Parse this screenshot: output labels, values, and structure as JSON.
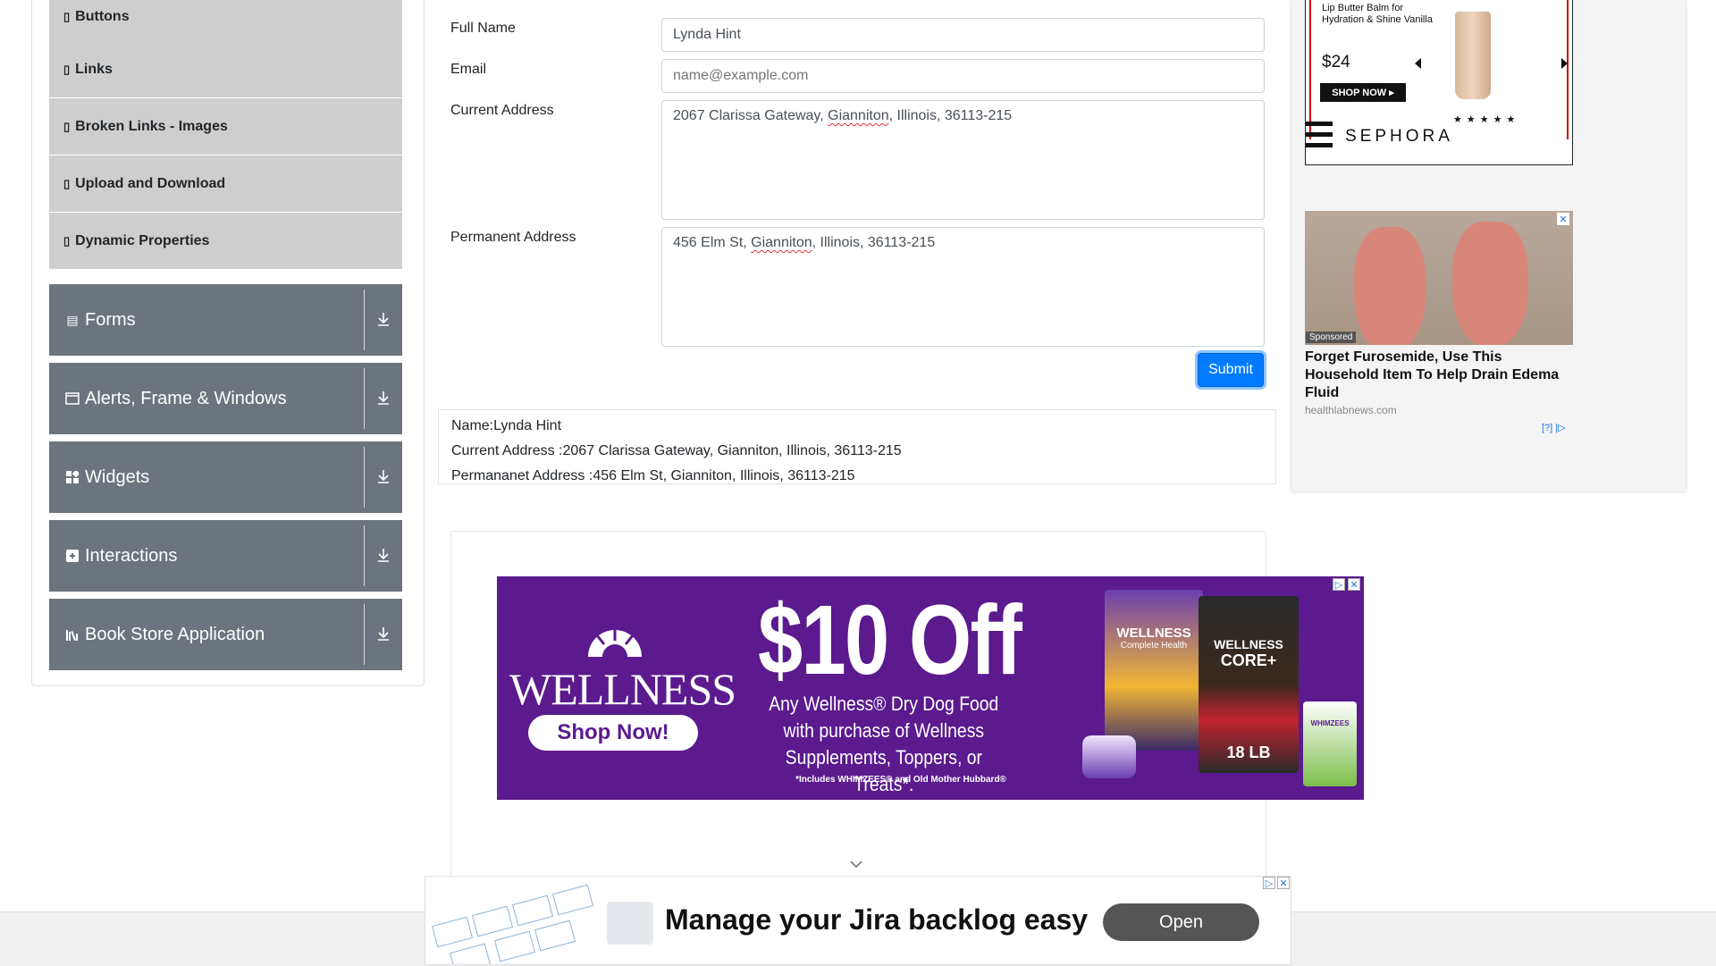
{
  "sidebar": {
    "sub_items": [
      {
        "label": "Buttons"
      },
      {
        "label": "Links"
      },
      {
        "label": "Broken Links - Images"
      },
      {
        "label": "Upload and Download"
      },
      {
        "label": "Dynamic Properties"
      }
    ],
    "groups": [
      {
        "label": "Forms",
        "icon": "form-icon"
      },
      {
        "label": "Alerts, Frame & Windows",
        "icon": "window-icon"
      },
      {
        "label": "Widgets",
        "icon": "widgets-icon"
      },
      {
        "label": "Interactions",
        "icon": "interactions-icon"
      },
      {
        "label": "Book Store Application",
        "icon": "bookstore-icon"
      }
    ]
  },
  "form": {
    "full_name_label": "Full Name",
    "full_name_value": "Lynda Hint",
    "email_label": "Email",
    "email_placeholder": "name@example.com",
    "current_address_label": "Current Address",
    "current_address_pre": "2067 Clarissa Gateway, ",
    "current_address_misspelled": "Gianniton",
    "current_address_post": ", Illinois, 36113-215",
    "permanent_address_label": "Permanent Address",
    "permanent_address_pre": "456 Elm St, ",
    "permanent_address_misspelled": "Gianniton",
    "permanent_address_post": ", Illinois, 36113-215",
    "submit_label": "Submit"
  },
  "output": {
    "name": "Name:Lynda Hint",
    "current_address": "Current Address :2067 Clarissa Gateway, Gianniton, Illinois, 36113-215",
    "permanent_address": "Permananet Address :456 Elm St, Gianniton, Illinois, 36113-215"
  },
  "ads": {
    "sephora": {
      "product_line1": "Lip Butter Balm for",
      "product_line2": "Hydration & Shine Vanilla",
      "price": "$24",
      "shop_label": "SHOP NOW ▸",
      "brand": "SEPHORA",
      "stars": "★★★★★"
    },
    "edema": {
      "sponsored": "Sponsored",
      "title": "Forget Furosemide, Use This Household Item To Help Drain Edema Fluid",
      "source": "healthlabnews.com",
      "adchoice": "[?] |▷"
    },
    "wellness": {
      "brand": "WELLNESS",
      "cta": "Shop Now!",
      "headline": "$10 Off",
      "sub1": "Any Wellness® Dry Dog Food",
      "sub2": "with purchase of Wellness",
      "sub3": "Supplements, Toppers, or Treats*.",
      "fine": "*Includes WHIMZEES® and Old Mother Hubbard®",
      "bag1_brand": "WELLNESS",
      "bag1_sub": "Complete Health",
      "bag2_brand": "WELLNESS",
      "bag2_sub": "CORE+",
      "bag2_weight": "18 LB",
      "bag3_brand": "WHIMZEES"
    },
    "jira": {
      "title": "Manage your Jira backlog easy",
      "open_label": "Open"
    }
  },
  "colors": {
    "group_bg": "#6c757d",
    "sub_bg": "#cecece",
    "primary": "#007bff",
    "wellness_purple": "#5b1a8e"
  }
}
